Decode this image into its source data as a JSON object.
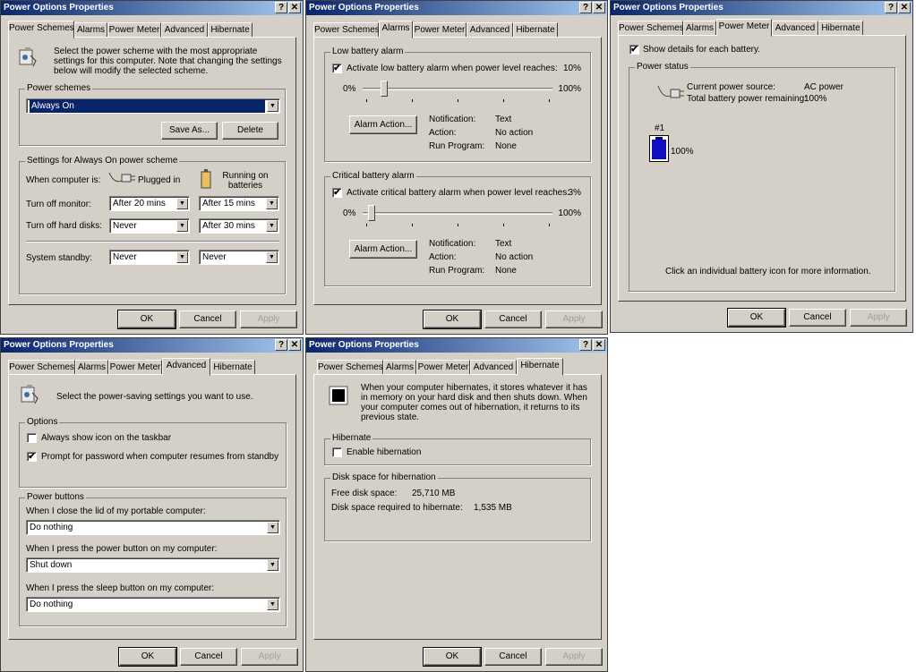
{
  "windows": [
    {
      "title": "Power Options Properties",
      "tabs": [
        "Power Schemes",
        "Alarms",
        "Power Meter",
        "Advanced",
        "Hibernate"
      ],
      "buttons": {
        "ok": "OK",
        "cancel": "Cancel",
        "apply": "Apply"
      },
      "help": "?",
      "close": "✕"
    }
  ],
  "schemes": {
    "intro": "Select the power scheme with the most appropriate settings for this computer. Note that changing the settings below will modify the selected scheme.",
    "group_schemes": "Power schemes",
    "selected_scheme": "Always On",
    "save_as": "Save As...",
    "delete": "Delete",
    "group_settings": "Settings for Always On power scheme",
    "when_computer_is": "When computer is:",
    "plugged_in": "Plugged in",
    "on_batteries": "Running on batteries",
    "monitor_label": "Turn off monitor:",
    "monitor_ac": "After 20 mins",
    "monitor_dc": "After 15 mins",
    "disks_label": "Turn off hard disks:",
    "disks_ac": "Never",
    "disks_dc": "After 30 mins",
    "standby_label": "System standby:",
    "standby_ac": "Never",
    "standby_dc": "Never"
  },
  "alarms": {
    "low_group": "Low battery alarm",
    "low_check": "Activate low battery alarm when power level reaches:",
    "low_value": "10%",
    "low_level": 0.1,
    "critical_group": "Critical battery alarm",
    "critical_check": "Activate critical battery alarm when power level reaches:",
    "critical_value": "3%",
    "critical_level": 0.03,
    "min": "0%",
    "max": "100%",
    "alarm_action": "Alarm Action...",
    "notification_label": "Notification:",
    "notification_value": "Text",
    "action_label": "Action:",
    "action_value": "No action",
    "program_label": "Run Program:",
    "program_value": "None"
  },
  "meter": {
    "show_details": "Show details for each battery.",
    "group": "Power status",
    "source_label": "Current power source:",
    "source_value": "AC power",
    "remaining_label": "Total battery power remaining:",
    "remaining_value": "100%",
    "battery_id": "#1",
    "battery_pct": "100%",
    "battery_level": 1.0,
    "hint": "Click an individual battery icon for more information."
  },
  "advanced": {
    "intro": "Select the power-saving settings you want to use.",
    "options_group": "Options",
    "opt_taskbar": "Always show icon on the taskbar",
    "opt_password": "Prompt for password when computer resumes from standby",
    "buttons_group": "Power buttons",
    "lid_label": "When I close the lid of my portable computer:",
    "lid_value": "Do nothing",
    "power_label": "When I press the power button on my computer:",
    "power_value": "Shut down",
    "sleep_label": "When I press the sleep button on my computer:",
    "sleep_value": "Do nothing"
  },
  "hibernate": {
    "intro": "When your computer hibernates, it stores whatever it has in memory on your hard disk and then shuts down. When your computer comes out of hibernation, it returns to its previous state.",
    "group": "Hibernate",
    "enable": "Enable hibernation",
    "disk_group": "Disk space for hibernation",
    "free_label": "Free disk space:",
    "free_value": "25,710 MB",
    "required_label": "Disk space required to hibernate:",
    "required_value": "1,535 MB"
  },
  "icons": {
    "check": "✔",
    "arrow": "▼"
  }
}
